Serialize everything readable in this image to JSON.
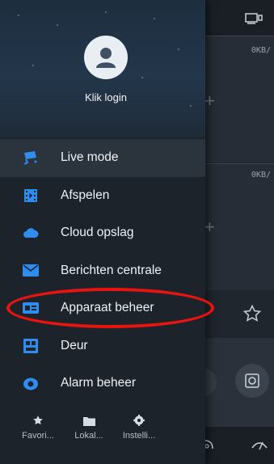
{
  "background": {
    "speed_top": "0KB/",
    "speed_bottom": "0KB/",
    "plus": "+"
  },
  "drawer": {
    "login_label": "Klik login",
    "menu": [
      {
        "label": "Live mode",
        "icon": "camera-icon",
        "active": true
      },
      {
        "label": "Afspelen",
        "icon": "film-icon"
      },
      {
        "label": "Cloud opslag",
        "icon": "cloud-icon"
      },
      {
        "label": "Berichten centrale",
        "icon": "envelope-icon"
      },
      {
        "label": "Apparaat beheer",
        "icon": "device-manager-icon"
      },
      {
        "label": "Deur",
        "icon": "door-icon"
      },
      {
        "label": "Alarm beheer",
        "icon": "alarm-icon"
      }
    ],
    "bottom": [
      {
        "label": "Favori...",
        "icon": "star-icon"
      },
      {
        "label": "Lokal...",
        "icon": "folder-icon"
      },
      {
        "label": "Instelli...",
        "icon": "gear-icon"
      }
    ]
  },
  "colors": {
    "accent_blue": "#2f8df0",
    "highlight_red": "#e8140f",
    "drawer_bg": "#1d232b"
  }
}
